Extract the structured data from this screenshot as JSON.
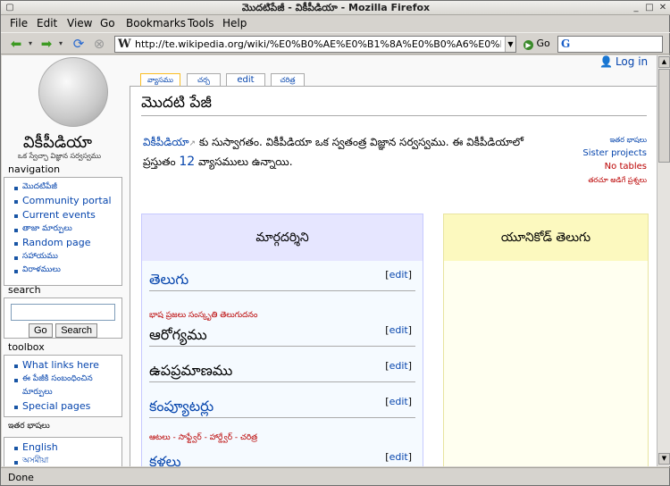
{
  "window": {
    "title": "మొదటిపేజీ - వికీపీడియా - Mozilla Firefox"
  },
  "menu": [
    "File",
    "Edit",
    "View",
    "Go",
    "Bookmarks",
    "Tools",
    "Help"
  ],
  "nav": {
    "url": "http://te.wikipedia.org/wiki/%E0%B0%AE%E0%B1%8A%E0%B0%A6%E0%B0%9F",
    "go_label": "Go",
    "search_engine": "G"
  },
  "status": "Done",
  "wiki": {
    "logo_title": "వికీపీడియా",
    "logo_tagline": "ఒక స్వేచ్ఛా విజ్ఞాన సర్వస్వము",
    "login": "Log in",
    "tabs": [
      "వ్యాసము",
      "చర్చ",
      "edit",
      "చరిత్ర"
    ],
    "heading": "మొదటి పేజీ",
    "intro_link": "వికీపీడియా",
    "intro_text_1": "కు సుస్వాగతం. వికీపీడియా ఒక స్వతంత్ర విజ్ఞాన సర్వస్వము. ఈ వికీపీడియాలో",
    "intro_text_2a": "ప్రస్తుతం",
    "article_count": "12",
    "intro_text_2b": "వ్యాసములు ఉన్నాయి.",
    "side_links": [
      "ఇతర భాషలు",
      "Sister projects",
      "No tables",
      "తరచూ అడిగే ప్రశ్నలు"
    ],
    "navigation": {
      "title": "navigation",
      "items": [
        "మొదటిపేజీ",
        "Community portal",
        "Current events",
        "తాజా మార్పులు",
        "Random page",
        "సహాయము",
        "విరాళములు"
      ]
    },
    "search": {
      "title": "search",
      "go": "Go",
      "search": "Search"
    },
    "toolbox": {
      "title": "toolbox",
      "items": [
        "What links here",
        "ఈ పేజీకి సంబంధించిన మార్పులు",
        "Special pages"
      ]
    },
    "languages": {
      "title": "ఇతర భాషలు",
      "items": [
        "English",
        "অসমীয়া"
      ]
    },
    "left_box": {
      "header": "మార్గదర్శిని",
      "edit_label": "edit",
      "sections": [
        {
          "title": "తెలుగు",
          "sub": "భాష ప్రజలు సంస్కృతి తెలుగుదనం"
        },
        {
          "title": "ఆరోగ్యము",
          "sub": ""
        },
        {
          "title": "ఉపప్రమాణము",
          "sub": ""
        },
        {
          "title": "కంప్యూటర్లు",
          "sub": "ఆటలు - సాఫ్ట్వేర్ - హార్డ్వేర్ - చరిత్ర"
        },
        {
          "title": "కళలు",
          "sub": ""
        }
      ]
    },
    "right_box": {
      "header": "యూనికోడ్ తెలుగు"
    }
  }
}
